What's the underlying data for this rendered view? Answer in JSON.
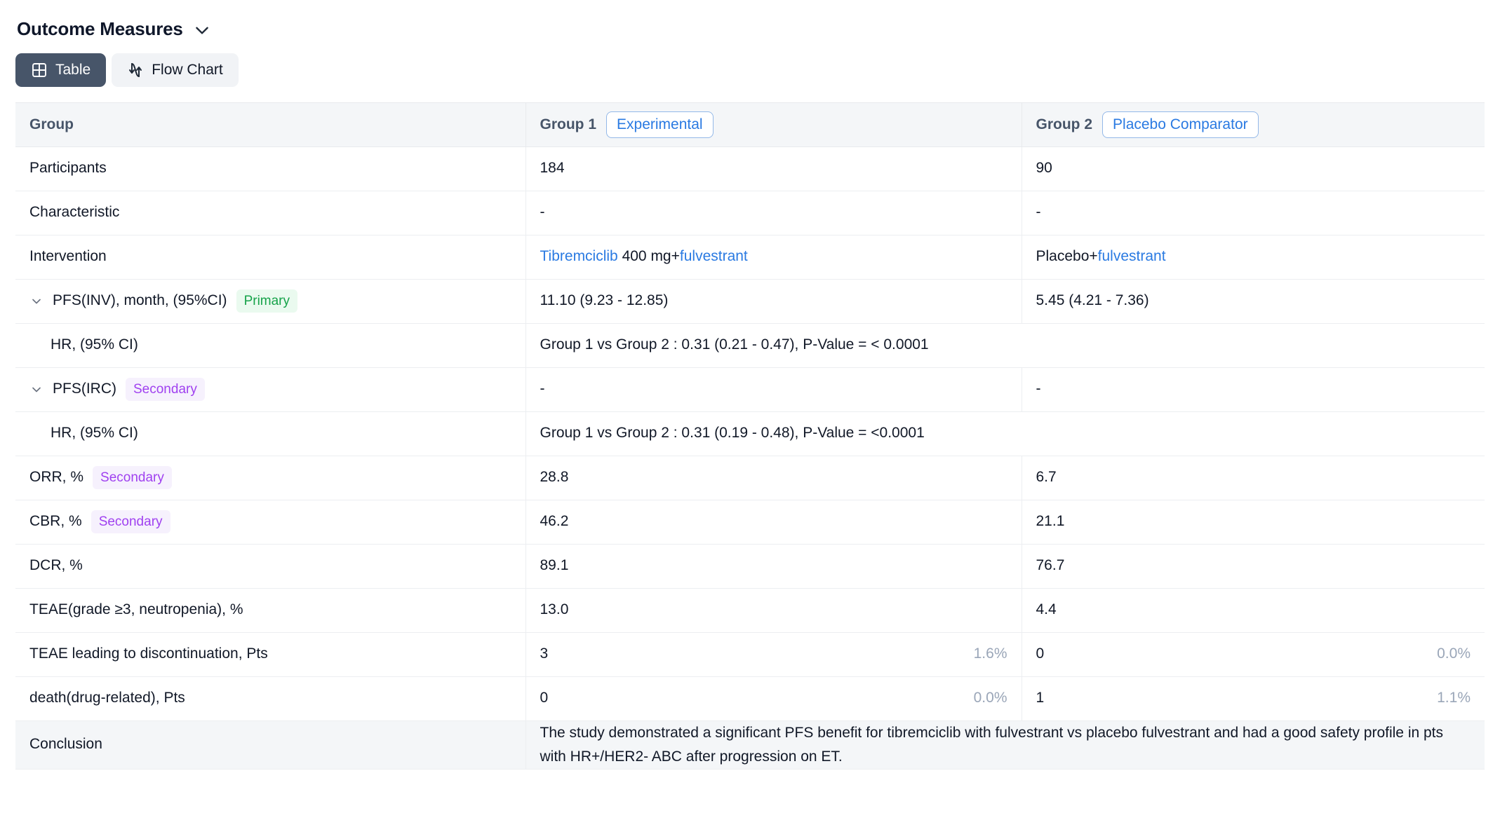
{
  "header": {
    "title": "Outcome Measures",
    "collapse_icon": "chevron-down-icon"
  },
  "view_toggle": {
    "table_label": "Table",
    "table_icon": "table-grid-icon",
    "flow_label": "Flow Chart",
    "flow_icon": "flow-arrows-icon",
    "active": "Table"
  },
  "colors": {
    "active_button_bg": "#475569",
    "inactive_button_bg": "#f1f3f6",
    "header_bg": "#f4f6f8",
    "link": "#2a7ae2",
    "pill_border": "#93b8e8",
    "primary_tag_bg": "#eafaef",
    "primary_tag_fg": "#16a34a",
    "secondary_tag_bg": "#f6f1fd",
    "secondary_tag_fg": "#a041f0",
    "muted_pct": "#9aa6b8",
    "row_border": "#eceef1"
  },
  "table": {
    "columns": [
      {
        "label": "Group",
        "badge": null
      },
      {
        "label": "Group 1",
        "badge": "Experimental"
      },
      {
        "label": "Group 2",
        "badge": "Placebo Comparator"
      }
    ],
    "rows": [
      {
        "type": "plain",
        "label": "Participants",
        "g1": "184",
        "g2": "90"
      },
      {
        "type": "plain",
        "label": "Characteristic",
        "g1": "-",
        "g2": "-"
      },
      {
        "type": "intervention",
        "label": "Intervention",
        "g1_parts": [
          {
            "text": "Tibremciclib",
            "link": true
          },
          {
            "text": " 400 mg+",
            "link": false
          },
          {
            "text": "fulvestrant",
            "link": true
          }
        ],
        "g2_parts": [
          {
            "text": "Placebo+",
            "link": false
          },
          {
            "text": "fulvestrant",
            "link": true
          }
        ]
      },
      {
        "type": "expandable",
        "label": "PFS(INV), month, (95%CI)",
        "tag": "Primary",
        "tag_kind": "primary",
        "g1": "11.10 (9.23 - 12.85)",
        "g2": "5.45 (4.21 - 7.36)"
      },
      {
        "type": "span",
        "label": "HR, (95% CI)",
        "indent": true,
        "span_text": "Group 1 vs Group 2 : 0.31 (0.21 - 0.47), P-Value = < 0.0001"
      },
      {
        "type": "expandable",
        "label": "PFS(IRC)",
        "tag": "Secondary",
        "tag_kind": "secondary",
        "g1": "-",
        "g2": "-"
      },
      {
        "type": "span",
        "label": "HR, (95% CI)",
        "indent": true,
        "span_text": "Group 1 vs Group 2 : 0.31 (0.19 - 0.48), P-Value = <0.0001"
      },
      {
        "type": "tagged",
        "label": "ORR, %",
        "tag": "Secondary",
        "tag_kind": "secondary",
        "g1": "28.8",
        "g2": "6.7"
      },
      {
        "type": "tagged",
        "label": "CBR, %",
        "tag": "Secondary",
        "tag_kind": "secondary",
        "g1": "46.2",
        "g2": "21.1"
      },
      {
        "type": "plain",
        "label": "DCR, %",
        "g1": "89.1",
        "g2": "76.7"
      },
      {
        "type": "plain",
        "label": "TEAE(grade ≥3, neutropenia), %",
        "g1": "13.0",
        "g2": "4.4"
      },
      {
        "type": "pct",
        "label": "TEAE leading to discontinuation, Pts",
        "g1": "3",
        "g1_pct": "1.6%",
        "g2": "0",
        "g2_pct": "0.0%"
      },
      {
        "type": "pct",
        "label": "death(drug-related), Pts",
        "g1": "0",
        "g1_pct": "0.0%",
        "g2": "1",
        "g2_pct": "1.1%"
      }
    ],
    "conclusion": {
      "label": "Conclusion",
      "text": "The study demonstrated a significant PFS benefit for tibremciclib with fulvestrant vs placebo fulvestrant and had a good safety profile in pts with HR+/HER2- ABC after progression on ET."
    }
  }
}
